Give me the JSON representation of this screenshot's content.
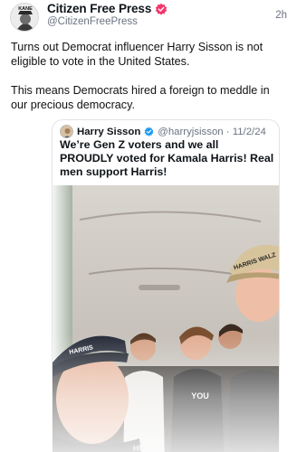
{
  "post": {
    "author": {
      "display_name": "Citizen Free Press",
      "handle": "@CitizenFreePress",
      "avatar_text": "KANE"
    },
    "timestamp": "2h",
    "paragraphs": [
      "Turns out Democrat influencer Harry Sisson is not eligible to vote in the United States.",
      "This means Democrats hired a foreign to meddle in our precious democracy."
    ],
    "quoted": {
      "display_name": "Harry Sisson",
      "handle_date": "@harryjsisson · 11/2/24",
      "text": "We’re Gen Z voters and we all PROUDLY voted for Kamala Harris! Real men support Harris!",
      "photo_labels": {
        "cap_left": "HARRIS",
        "cap_right": "HARRIS WALZ",
        "shirt": "YOU",
        "shirt_left": "HUL"
      }
    }
  },
  "colors": {
    "verified_badge": "#f0386b",
    "quoted_verified_badge": "#1d9bf0",
    "handle_text": "#6b7280",
    "border": "#e1e4e8"
  }
}
